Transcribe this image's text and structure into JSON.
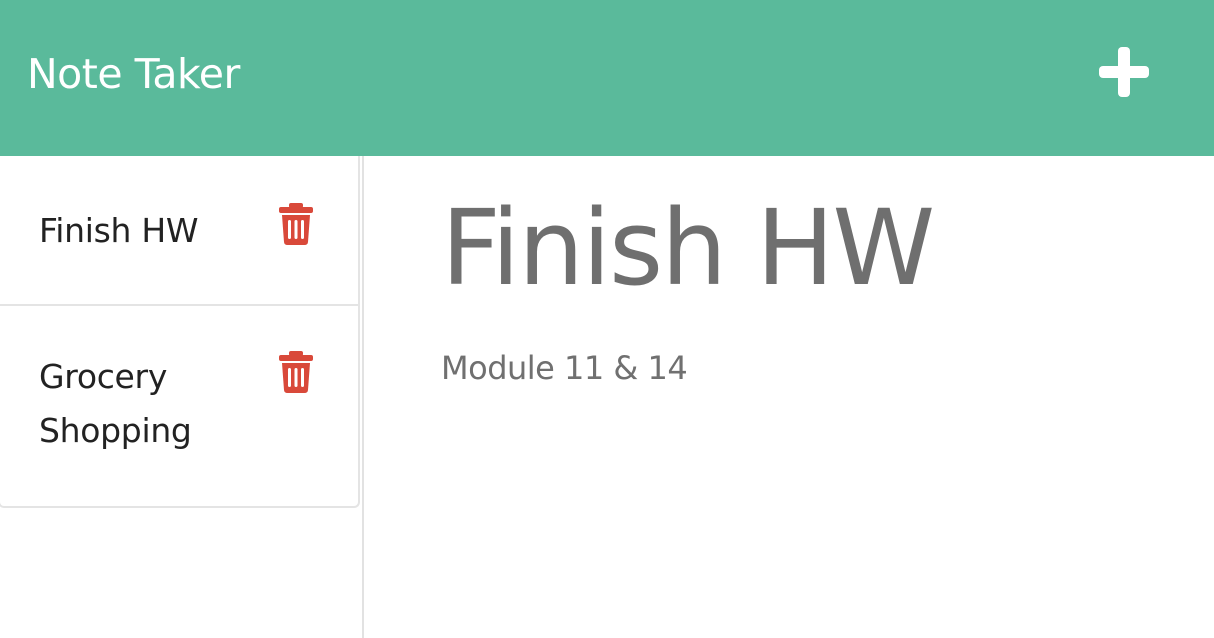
{
  "app": {
    "title": "Note Taker"
  },
  "toolbar": {
    "new_note_icon": "plus-icon"
  },
  "colors": {
    "navbar": "#5aba9b",
    "trash": "#d9493a",
    "heading_text": "#6f6f6f"
  },
  "sidebar": {
    "notes": [
      {
        "title": "Finish HW",
        "delete_icon": "trash-icon"
      },
      {
        "title": "Grocery Shopping",
        "delete_icon": "trash-icon"
      }
    ]
  },
  "active_note": {
    "title": "Finish HW",
    "text": "Module 11 & 14"
  }
}
